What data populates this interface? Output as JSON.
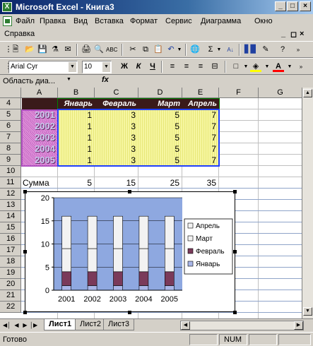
{
  "window": {
    "title": "Microsoft Excel - Книга3",
    "app_icon_glyph": "X",
    "btn_min": "_",
    "btn_max": "□",
    "btn_close": "×"
  },
  "menu": {
    "items": [
      "Файл",
      "Правка",
      "Вид",
      "Вставка",
      "Формат",
      "Сервис",
      "Диаграмма",
      "Окно"
    ],
    "help": "Справка"
  },
  "toolbar": {
    "font_name": "Arial Cyr",
    "font_size": "10",
    "bold": "Ж",
    "italic": "К",
    "underline": "Ч"
  },
  "formula": {
    "name_box": "Область диа...",
    "fx": "fx"
  },
  "sheet": {
    "columns": [
      "A",
      "B",
      "C",
      "D",
      "E",
      "F",
      "G"
    ],
    "rows": [
      "4",
      "5",
      "6",
      "7",
      "8",
      "9",
      "10",
      "11",
      "12",
      "13",
      "14",
      "15",
      "16",
      "17",
      "18",
      "19",
      "20",
      "21",
      "22"
    ],
    "headers": [
      "Январь",
      "Февраль",
      "Март",
      "Апрель"
    ],
    "years": [
      "2001",
      "2002",
      "2003",
      "2004",
      "2005"
    ],
    "data": [
      [
        1,
        3,
        5,
        7
      ],
      [
        1,
        3,
        5,
        7
      ],
      [
        1,
        3,
        5,
        7
      ],
      [
        1,
        3,
        5,
        7
      ],
      [
        1,
        3,
        5,
        7
      ]
    ],
    "sum_label": "Сумма",
    "sums": [
      5,
      15,
      25,
      35
    ]
  },
  "chart_data": {
    "type": "bar",
    "stacked": true,
    "categories": [
      "2001",
      "2002",
      "2003",
      "2004",
      "2005"
    ],
    "series": [
      {
        "name": "Январь",
        "values": [
          1,
          1,
          1,
          1,
          1
        ],
        "color": "#a9b6e8"
      },
      {
        "name": "Февраль",
        "values": [
          3,
          3,
          3,
          3,
          3
        ],
        "color": "#7a3a5a"
      },
      {
        "name": "Март",
        "values": [
          5,
          5,
          5,
          5,
          5
        ],
        "color": "#f2f2f2"
      },
      {
        "name": "Апрель",
        "values": [
          7,
          7,
          7,
          7,
          7
        ],
        "color": "#f2f2f2"
      }
    ],
    "yticks": [
      "0",
      "5",
      "10",
      "15",
      "20"
    ],
    "ylim": [
      0,
      20
    ],
    "plot_bg": "#8ea8e0",
    "legend_order": [
      "Апрель",
      "Март",
      "Февраль",
      "Январь"
    ],
    "legend_position": "right"
  },
  "tabs": [
    "Лист1",
    "Лист2",
    "Лист3"
  ],
  "status": {
    "left": "Готово",
    "num": "NUM"
  }
}
